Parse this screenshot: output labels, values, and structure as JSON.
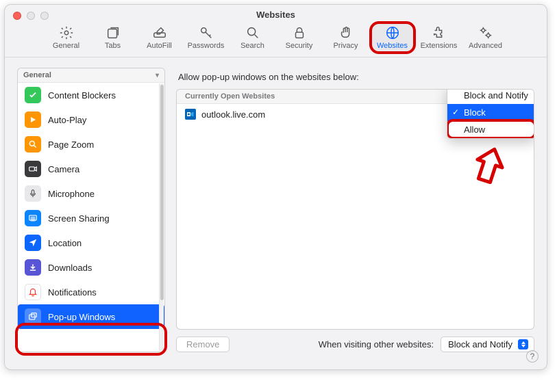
{
  "title": "Websites",
  "toolbar": [
    {
      "id": "general",
      "label": "General"
    },
    {
      "id": "tabs",
      "label": "Tabs"
    },
    {
      "id": "autofill",
      "label": "AutoFill"
    },
    {
      "id": "passwords",
      "label": "Passwords"
    },
    {
      "id": "search",
      "label": "Search"
    },
    {
      "id": "security",
      "label": "Security"
    },
    {
      "id": "privacy",
      "label": "Privacy"
    },
    {
      "id": "websites",
      "label": "Websites"
    },
    {
      "id": "extensions",
      "label": "Extensions"
    },
    {
      "id": "advanced",
      "label": "Advanced"
    }
  ],
  "sidebar": {
    "header": "General",
    "items": [
      {
        "label": "Content Blockers",
        "color": "#34c759"
      },
      {
        "label": "Auto-Play",
        "color": "#ff9500"
      },
      {
        "label": "Page Zoom",
        "color": "#ff9500"
      },
      {
        "label": "Camera",
        "color": "#3a3a3c"
      },
      {
        "label": "Microphone",
        "color": "#c8c8cc"
      },
      {
        "label": "Screen Sharing",
        "color": "#0a84ff"
      },
      {
        "label": "Location",
        "color": "#0a66ff"
      },
      {
        "label": "Downloads",
        "color": "#5856d6"
      },
      {
        "label": "Notifications",
        "color": "#ffffff"
      },
      {
        "label": "Pop-up Windows",
        "color": "#0a66ff"
      }
    ]
  },
  "main": {
    "intro": "Allow pop-up windows on the websites below:",
    "columns_header": "Currently Open Websites",
    "rows": [
      {
        "site": "outlook.live.com"
      }
    ],
    "dropdown": {
      "options": [
        "Block and Notify",
        "Block",
        "Allow"
      ],
      "selected": "Block"
    },
    "remove_label": "Remove",
    "footer_label": "When visiting other websites:",
    "footer_select": "Block and Notify"
  },
  "help": "?"
}
